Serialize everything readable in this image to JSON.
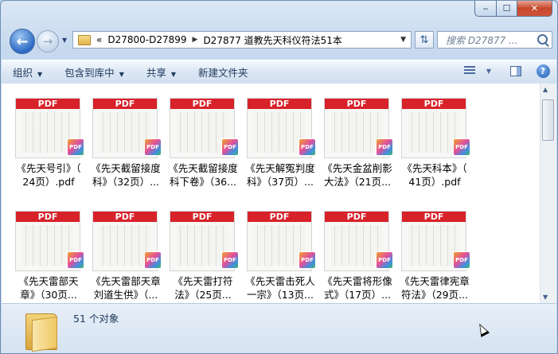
{
  "window": {
    "caption": {
      "min": "‒",
      "max": "☐",
      "close": "✕"
    }
  },
  "address": {
    "prefix": "«",
    "crumbs": [
      "D27800-D27899",
      "D27877 道教先天科仪符法51本"
    ],
    "search_placeholder": "搜索 D27877 ..."
  },
  "toolbar": {
    "items": [
      {
        "label": "组织",
        "dropdown": true
      },
      {
        "label": "包含到库中",
        "dropdown": true
      },
      {
        "label": "共享",
        "dropdown": true
      },
      {
        "label": "新建文件夹",
        "dropdown": false
      }
    ]
  },
  "file_badge": "PDF",
  "files": [
    {
      "line1": "《先天号引》（",
      "line2": "24页）.pdf"
    },
    {
      "line1": "《先天截留接度",
      "line2": "科》（32页）..."
    },
    {
      "line1": "《先天截留接度",
      "line2": "科下卷》（36..."
    },
    {
      "line1": "《先天解冤判度",
      "line2": "科》（37页）..."
    },
    {
      "line1": "《先天金盆削影",
      "line2": "大法》（21页..."
    },
    {
      "line1": "《先天科本》（",
      "line2": "41页）.pdf"
    },
    {
      "line1": "《先天雷部天",
      "line2": "章》（30页..."
    },
    {
      "line1": "《先天雷部天章",
      "line2": "刘道生供》（..."
    },
    {
      "line1": "《先天雷打符",
      "line2": "法》（25页..."
    },
    {
      "line1": "《先天雷击死人",
      "line2": "一宗》（13页..."
    },
    {
      "line1": "《先天雷将形像",
      "line2": "式》（17页）..."
    },
    {
      "line1": "《先天雷律宪章",
      "line2": "符法》（29页..."
    }
  ],
  "status": {
    "count": "51 个对象"
  }
}
